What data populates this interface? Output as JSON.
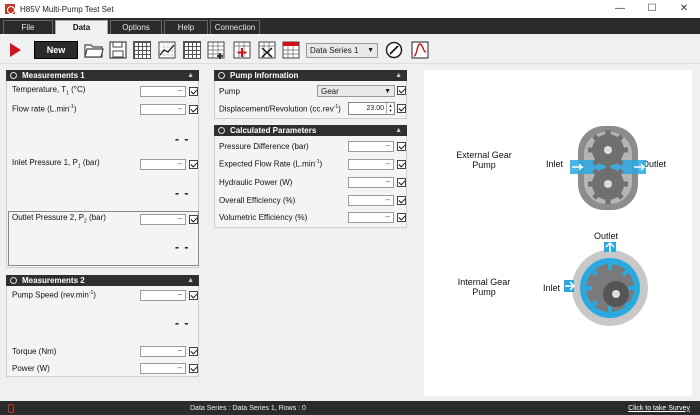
{
  "window": {
    "title": "H85V Multi-Pump Test Set"
  },
  "menu": {
    "tabs": [
      "File",
      "Data",
      "Options",
      "Help",
      "Connection"
    ],
    "active": "Data"
  },
  "toolbar": {
    "new_label": "New",
    "series_select": "Data Series 1"
  },
  "measurements1": {
    "title": "Measurements 1",
    "rows": [
      {
        "label": "Temperature, T",
        "sub": "1",
        "unit": " (°C)",
        "value": "--"
      },
      {
        "label": "Flow rate  (L.min",
        "sup": "-1",
        "unit": ")",
        "value": "--"
      },
      {
        "label": "Inlet Pressure 1, P",
        "sub": "1",
        "unit": " (bar)",
        "value": "--"
      },
      {
        "label": "Outlet Pressure 2, P",
        "sub": "2",
        "unit": " (bar)",
        "value": "--"
      }
    ],
    "live_readout": "- -"
  },
  "measurements2": {
    "title": "Measurements 2",
    "rows": [
      {
        "label": "Pump Speed  (rev.min",
        "sup": "-1",
        "unit": ")",
        "value": "--"
      },
      {
        "label": "Torque  (Nm)",
        "value": "--"
      },
      {
        "label": "Power  (W)",
        "value": "--"
      }
    ]
  },
  "pump_info": {
    "title": "Pump Information",
    "pump_label": "Pump",
    "pump_value": "Gear",
    "disp_label": "Displacement/Revolution  (cc.rev",
    "disp_sup": "-1",
    "disp_unit": ")",
    "disp_value": "23.00"
  },
  "calculated": {
    "title": "Calculated Parameters",
    "rows": [
      {
        "label": "Pressure Difference  (bar)",
        "value": "--"
      },
      {
        "label": "Expected Flow Rate  (L.min",
        "sup": "-1",
        "unit": ")",
        "value": "--"
      },
      {
        "label": "Hydraulic Power  (W)",
        "value": "--"
      },
      {
        "label": "Overall Efficiency  (%)",
        "value": "--"
      },
      {
        "label": "Volumetric Efficiency  (%)",
        "value": "--"
      }
    ]
  },
  "diagram": {
    "external_title_1": "External Gear",
    "external_title_2": "Pump",
    "internal_title_1": "Internal Gear",
    "internal_title_2": "Pump",
    "ext_inlet": "Inlet",
    "ext_outlet": "Outlet",
    "int_inlet": "Inlet",
    "int_outlet": "Outlet"
  },
  "status": {
    "text": "Data Series : Data Series 1,  Rows : 0",
    "survey": "Click to take Survey"
  },
  "colors": {
    "accent_red": "#d0121b",
    "fluid_blue": "#29a9e0",
    "gear_gray": "#8c8c8c"
  }
}
